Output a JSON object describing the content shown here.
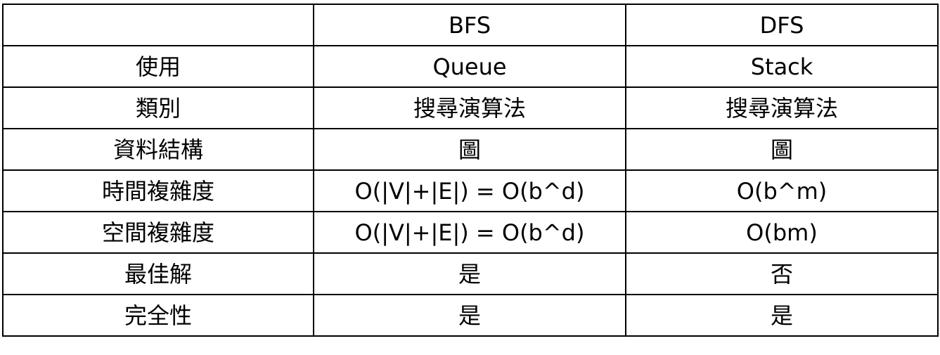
{
  "table": {
    "header": [
      "",
      "BFS",
      "DFS"
    ],
    "rows": [
      [
        "使用",
        "Queue",
        "Stack"
      ],
      [
        "類別",
        "搜尋演算法",
        "搜尋演算法"
      ],
      [
        "資料結構",
        "圖",
        "圖"
      ],
      [
        "時間複雜度",
        "O(|V|+|E|) = O(b^d)",
        "O(b^m)"
      ],
      [
        "空間複雜度",
        "O(|V|+|E|) = O(b^d)",
        "O(bm)"
      ],
      [
        "最佳解",
        "是",
        "否"
      ],
      [
        "完全性",
        "是",
        "是"
      ]
    ]
  }
}
